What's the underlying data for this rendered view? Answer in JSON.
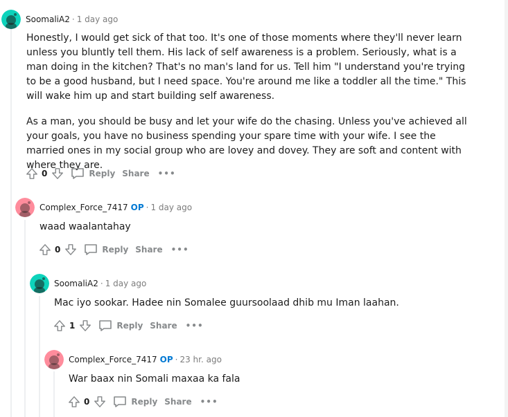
{
  "colors": {
    "op_badge": "#0079d3",
    "avatar_green": "#0dd3bb",
    "avatar_pink": "#ff8c9c"
  },
  "icons": {
    "upvote": "arrow-up-icon",
    "downvote": "arrow-down-icon",
    "reply": "speech-bubble-icon",
    "more": "ellipsis-icon"
  },
  "comments": [
    {
      "author": "SoomaliA2",
      "op": "",
      "time": "1 day ago",
      "paragraphs": [
        "Honestly, I would get sick of that too. It's one of those moments where they'll never learn unless you bluntly tell them. His lack of self awareness is a problem. Seriously, what is a man doing in the kitchen? That's no man's land for us. Tell him \"I understand you're trying to be a good husband, but I need space. You're around me like a toddler all the time.\" This will wake him up and start building self awareness.",
        "As a man, you should be busy and let your wife do the chasing. Unless you've achieved all your goals, you have no business spending your spare time with your wife. I see the married ones in my social group who are lovey and dovey. They are soft and content with where they are."
      ],
      "score": "0",
      "reply_label": "Reply",
      "share_label": "Share",
      "more_label": "•••"
    },
    {
      "author": "Complex_Force_7417",
      "op": "OP",
      "time": "1 day ago",
      "paragraphs": [
        "waad waalantahay"
      ],
      "score": "0",
      "reply_label": "Reply",
      "share_label": "Share",
      "more_label": "•••"
    },
    {
      "author": "SoomaliA2",
      "op": "",
      "time": "1 day ago",
      "paragraphs": [
        "Mac iyo sookar. Hadee nin Somalee guursoolaad dhib mu Iman laahan."
      ],
      "score": "1",
      "reply_label": "Reply",
      "share_label": "Share",
      "more_label": "•••"
    },
    {
      "author": "Complex_Force_7417",
      "op": "OP",
      "time": "23 hr. ago",
      "paragraphs": [
        "War baax nin Somali maxaa ka fala"
      ],
      "score": "0",
      "reply_label": "Reply",
      "share_label": "Share",
      "more_label": "•••"
    }
  ]
}
